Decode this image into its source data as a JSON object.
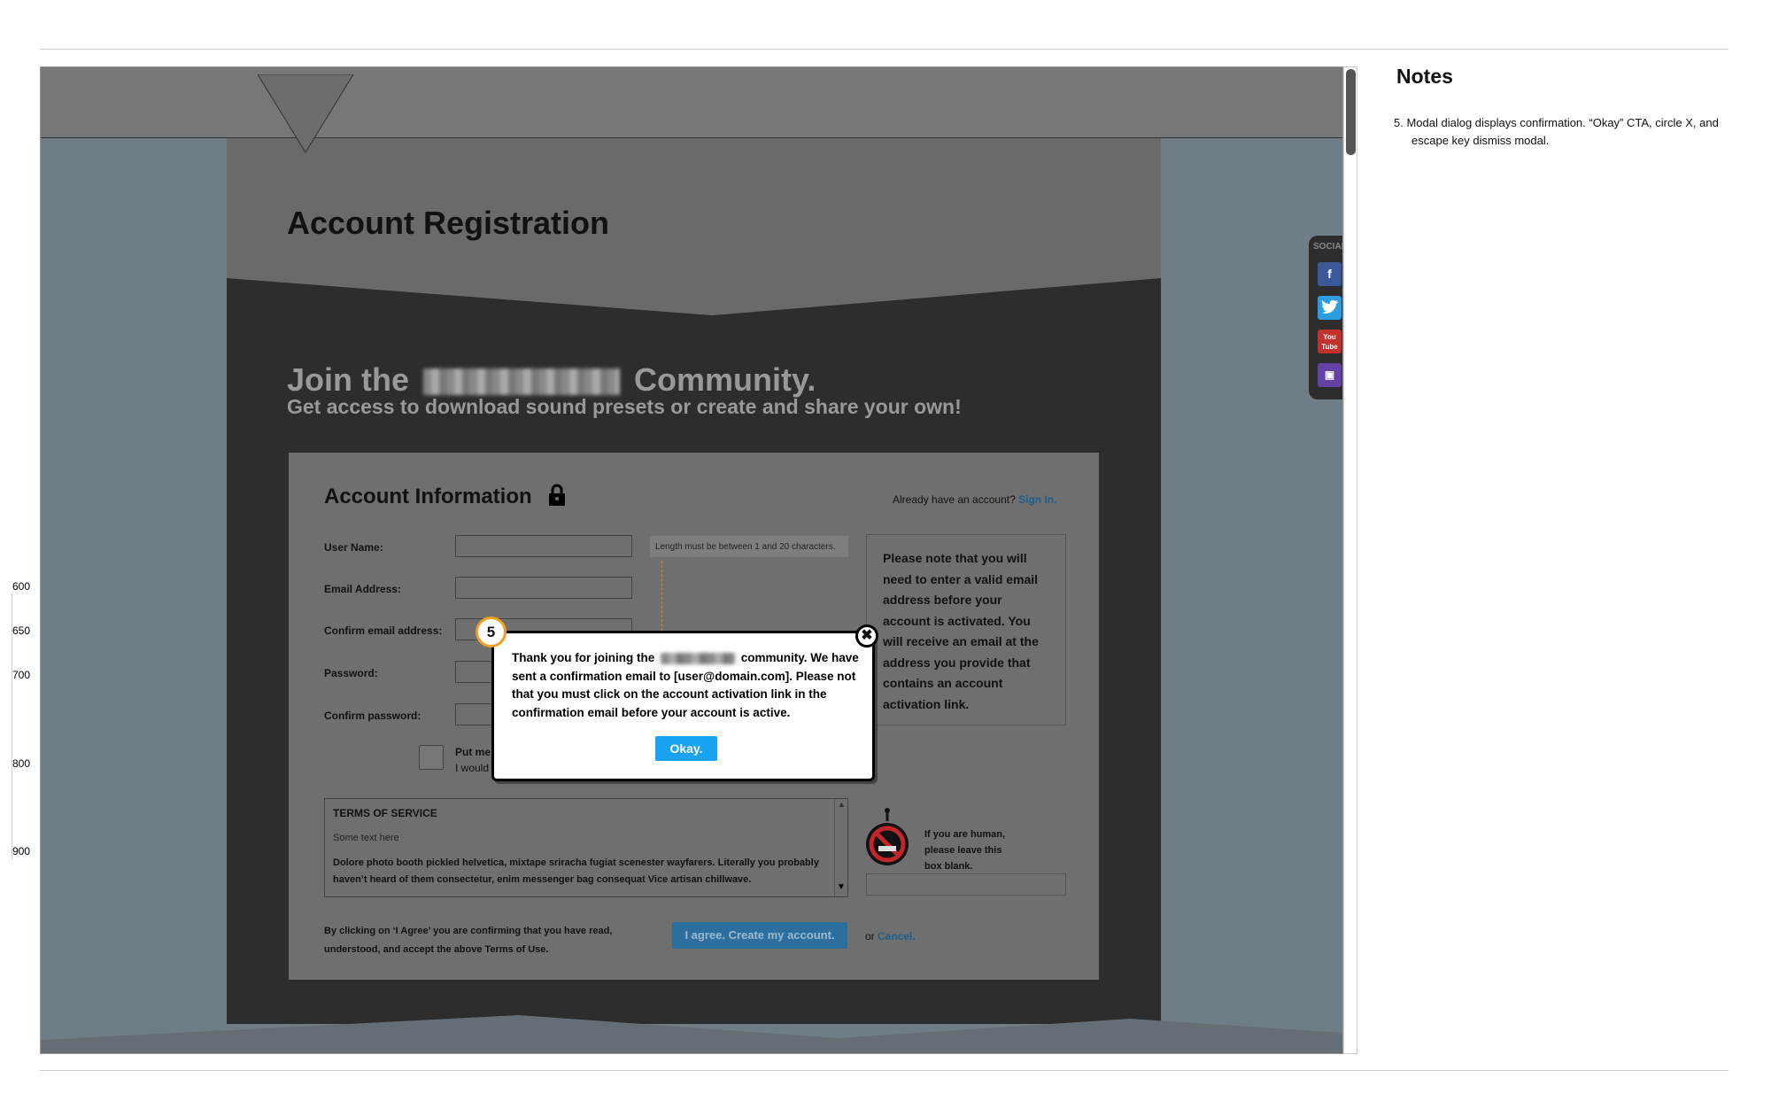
{
  "page": {
    "title": "Account Registration"
  },
  "join": {
    "prefix": "Join the",
    "suffix": "Community.",
    "subtitle": "Get access to download sound presets or create and share your own!"
  },
  "account": {
    "heading": "Account Information",
    "already": "Already have an account?",
    "signin": "Sign In.",
    "labels": {
      "username": "User Name:",
      "email": "Email Address:",
      "confirm_email": "Confirm email address:",
      "password": "Password:",
      "confirm_password": "Confirm password:"
    },
    "hint": "Length must be between 1 and 20 characters.",
    "note": "Please note that you will need to enter a valid email address before your account is activated. You will receive an email at the address you provide that contains an account activation link.",
    "checkbox_line1": "Put me",
    "checkbox_line2": "I would"
  },
  "tos": {
    "heading": "TERMS OF SERVICE",
    "placeholder": "Some text here",
    "body": "Dolore photo booth pickled helvetica, mixtape sriracha fugiat scenester wayfarers. Literally you probably haven’t heard of them consectetur, enim messenger bag consequat Vice artisan chillwave."
  },
  "captcha": {
    "text": "If you are human, please leave this box blank."
  },
  "agree": {
    "text": "By clicking on ‘I Agree’ you are confirming that you have read, understood, and accept the above Terms of Use.",
    "button": "I agree. Create my account.",
    "or": "or",
    "cancel": "Cancel."
  },
  "social": {
    "label": "SOCIAL",
    "icons": [
      "facebook-icon",
      "twitter-icon",
      "youtube-icon",
      "twitch-icon"
    ]
  },
  "modal": {
    "badge": "5",
    "text_1": "Thank you for joining the",
    "text_2": "community. We have sent a confirmation email to [user@domain.com]. Please not that you must click on the account activation link in the confirmation email before your account is active.",
    "okay": "Okay.",
    "close": "✖"
  },
  "notes": {
    "heading": "Notes",
    "item": "5. Modal dialog displays confirmation. “Okay” CTA, circle X, and escape key dismiss modal."
  },
  "ruler": [
    "600",
    "650",
    "700",
    "800",
    "900"
  ],
  "colors": {
    "accent": "#1aa3f0",
    "badge_border": "#f0a020",
    "link": "#1e5f8f"
  }
}
